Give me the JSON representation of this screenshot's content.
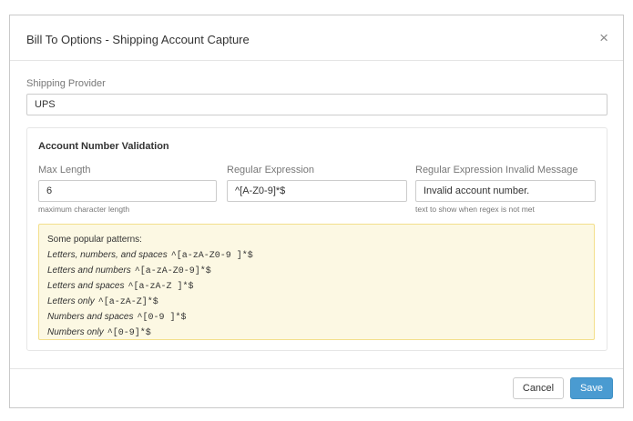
{
  "dialog": {
    "title": "Bill To Options - Shipping Account Capture",
    "close_glyph": "×"
  },
  "shipping_provider": {
    "label": "Shipping Provider",
    "value": "UPS"
  },
  "validation": {
    "title": "Account Number Validation",
    "max_length": {
      "label": "Max Length",
      "value": "6",
      "help": "maximum character length"
    },
    "regex": {
      "label": "Regular Expression",
      "value": "^[A-Z0-9]*$"
    },
    "invalid_message": {
      "label": "Regular Expression Invalid Message",
      "value": "Invalid account number.",
      "help": "text to show when regex is not met"
    }
  },
  "patterns": {
    "heading": "Some popular patterns:",
    "items": [
      {
        "label": "Letters, numbers, and spaces",
        "regex": "^[a-zA-Z0-9 ]*$"
      },
      {
        "label": "Letters and numbers",
        "regex": "^[a-zA-Z0-9]*$"
      },
      {
        "label": "Letters and spaces",
        "regex": "^[a-zA-Z ]*$"
      },
      {
        "label": "Letters only",
        "regex": "^[a-zA-Z]*$"
      },
      {
        "label": "Numbers and spaces",
        "regex": "^[0-9 ]*$"
      },
      {
        "label": "Numbers only",
        "regex": "^[0-9]*$"
      }
    ]
  },
  "footer": {
    "cancel_label": "Cancel",
    "save_label": "Save"
  },
  "colors": {
    "save_button": "#4a9bd1",
    "note_background": "#fcf8e3",
    "note_border": "#f3df8c"
  }
}
